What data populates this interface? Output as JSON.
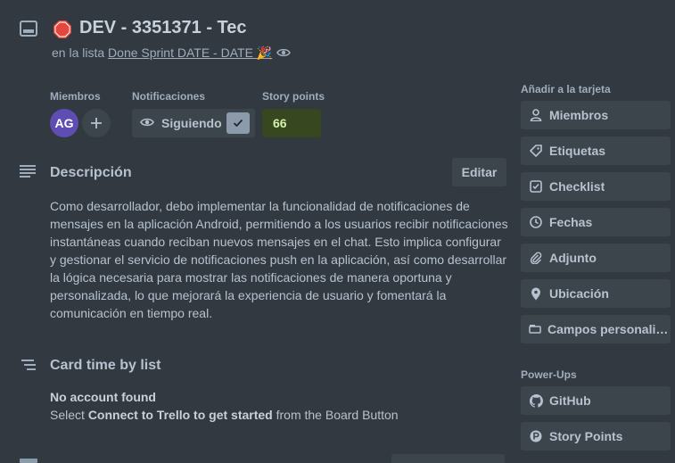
{
  "card": {
    "title": "DEV - 3351371 - Tec",
    "in_list_prefix": "en la lista",
    "list_name": "Done Sprint DATE - DATE 🎉"
  },
  "members": {
    "label": "Miembros",
    "avatar_initials": "AG"
  },
  "notifications": {
    "label": "Notificaciones",
    "button_label": "Siguiendo"
  },
  "story_points": {
    "label": "Story points",
    "value": "66"
  },
  "description": {
    "title": "Descripción",
    "edit_label": "Editar",
    "text": "Como desarrollador, debo implementar la funcionalidad de notificaciones de mensajes en la aplicación Android, permitiendo a los usuarios recibir notificaciones instantáneas cuando reciban nuevos mensajes en el chat. Esto implica configurar y gestionar el servicio de notificaciones push en la aplicación, así como desarrollar la lógica necesaria para mostrar las notificaciones de manera oportuna y personalizada, lo que mejorará la experiencia de usuario y fomentará la comunicación en tiempo real."
  },
  "card_time": {
    "title": "Card time by list",
    "no_account": "No account found",
    "select_prefix": "Select",
    "select_bold": "Connect to Trello to get started",
    "select_suffix": "from the Board Button"
  },
  "sidebar": {
    "add_label": "Añadir a la tarjeta",
    "items": [
      {
        "label": "Miembros",
        "icon": "person-icon"
      },
      {
        "label": "Etiquetas",
        "icon": "tag-icon"
      },
      {
        "label": "Checklist",
        "icon": "checklist-icon"
      },
      {
        "label": "Fechas",
        "icon": "clock-icon"
      },
      {
        "label": "Adjunto",
        "icon": "paperclip-icon"
      },
      {
        "label": "Ubicación",
        "icon": "location-pin-icon"
      },
      {
        "label": "Campos personalizados",
        "icon": "custom-fields-icon"
      }
    ],
    "powerups_label": "Power-Ups",
    "powerups": [
      {
        "label": "GitHub",
        "icon": "github-icon"
      },
      {
        "label": "Story Points",
        "icon": "story-points-icon"
      }
    ]
  },
  "colors": {
    "background": "#323940",
    "button": "#3d454c",
    "avatar": "#5e4db2",
    "story_points_bg": "#37471f",
    "stop": "#e2483d"
  }
}
